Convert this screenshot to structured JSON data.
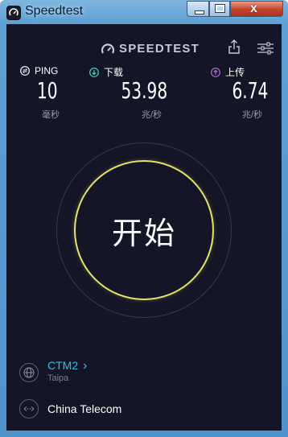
{
  "window": {
    "title": "Speedtest",
    "close_glyph": "x"
  },
  "header": {
    "logo_text": "SPEEDTEST",
    "share_icon": "share-icon",
    "settings_icon": "settings-sliders-icon"
  },
  "stats": {
    "ping": {
      "label": "PING",
      "value": "10",
      "unit": "毫秒",
      "color": "#ffffff"
    },
    "download": {
      "label": "下载",
      "value": "53.98",
      "unit": "兆/秒",
      "color": "#4fd1c5"
    },
    "upload": {
      "label": "上传",
      "value": "6.74",
      "unit": "兆/秒",
      "color": "#b66cdc"
    }
  },
  "go_button": {
    "label": "开始",
    "ring_color": "#e6e36b"
  },
  "server": {
    "name": "CTM2",
    "chevron": "›",
    "location": "Taipa"
  },
  "isp": {
    "name": "China Telecom"
  },
  "colors": {
    "background": "#141526",
    "accent_link": "#3fb8e8"
  }
}
